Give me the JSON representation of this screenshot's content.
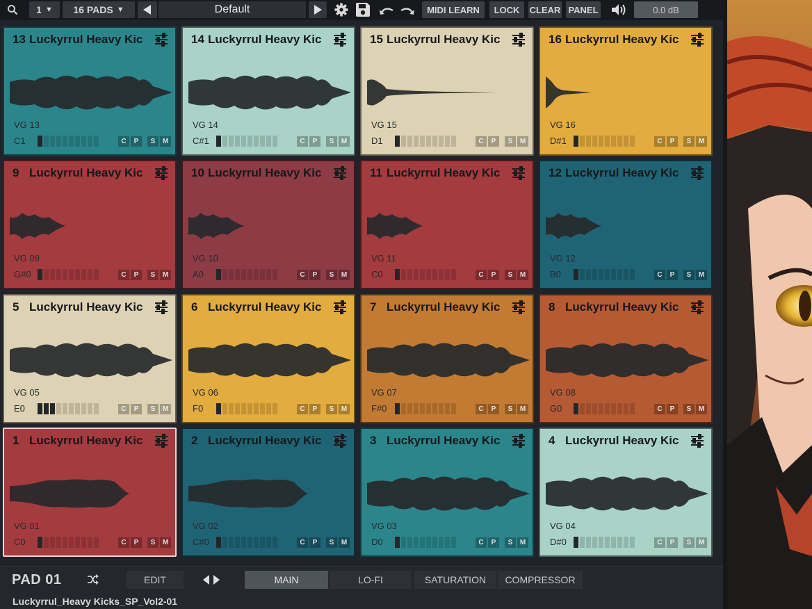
{
  "toolbar": {
    "channel": "1",
    "pads_mode": "16 PADS",
    "preset": "Default",
    "midi_learn": "MIDI LEARN",
    "lock": "LOCK",
    "clear": "CLEAR",
    "panel": "PANEL",
    "volume": "0.0 dB"
  },
  "colors": {
    "teal": "#2b868c",
    "pale_teal": "#a9d3c6",
    "cream": "#ddd2b3",
    "gold": "#e3ac3e",
    "red": "#a43b3f",
    "wine": "#8d3b45",
    "dark_teal": "#1f6475",
    "orange": "#c37b33",
    "rust": "#b65a33",
    "waveform": "#26292b"
  },
  "pads": [
    {
      "num": "13",
      "name": "Luckyrrul Heavy Kic",
      "vg": "VG 13",
      "note": "C1",
      "color": "#2b868c",
      "level": 1,
      "wave": "long"
    },
    {
      "num": "14",
      "name": "Luckyrrul Heavy Kic",
      "vg": "VG 14",
      "note": "C#1",
      "color": "#a9d3c6",
      "level": 1,
      "wave": "long"
    },
    {
      "num": "15",
      "name": "Luckyrrul Heavy Kic",
      "vg": "VG 15",
      "note": "D1",
      "color": "#ddd2b3",
      "level": 1,
      "wave": "decay"
    },
    {
      "num": "16",
      "name": "Luckyrrul Heavy Kic",
      "vg": "VG 16",
      "note": "D#1",
      "color": "#e3ac3e",
      "level": 1,
      "wave": "shortdecay"
    },
    {
      "num": "9",
      "name": "Luckyrrul Heavy Kic",
      "vg": "VG 09",
      "note": "G#0",
      "color": "#a43b3f",
      "level": 1,
      "wave": "short"
    },
    {
      "num": "10",
      "name": "Luckyrrul Heavy Kic",
      "vg": "VG 10",
      "note": "A0",
      "color": "#8d3b45",
      "level": 1,
      "wave": "short"
    },
    {
      "num": "11",
      "name": "Luckyrrul Heavy Kic",
      "vg": "VG 11",
      "note": "C0",
      "color": "#a43b3f",
      "level": 1,
      "wave": "short"
    },
    {
      "num": "12",
      "name": "Luckyrrul Heavy Kic",
      "vg": "VG 12",
      "note": "B0",
      "color": "#1f6475",
      "level": 1,
      "wave": "short"
    },
    {
      "num": "5",
      "name": "Luckyrrul Heavy Kic",
      "vg": "VG 05",
      "note": "E0",
      "color": "#ddd2b3",
      "level": 3,
      "wave": "long"
    },
    {
      "num": "6",
      "name": "Luckyrrul Heavy Kic",
      "vg": "VG 06",
      "note": "F0",
      "color": "#e3ac3e",
      "level": 1,
      "wave": "long"
    },
    {
      "num": "7",
      "name": "Luckyrrul Heavy Kic",
      "vg": "VG 07",
      "note": "F#0",
      "color": "#c37b33",
      "level": 1,
      "wave": "long"
    },
    {
      "num": "8",
      "name": "Luckyrrul Heavy Kic",
      "vg": "VG 08",
      "note": "G0",
      "color": "#b65a33",
      "level": 1,
      "wave": "long"
    },
    {
      "num": "1",
      "name": "Luckyrrul Heavy Kic",
      "vg": "VG 01",
      "note": "C0",
      "color": "#a43b3f",
      "level": 1,
      "wave": "medium",
      "selected": true
    },
    {
      "num": "2",
      "name": "Luckyrrul Heavy Kic",
      "vg": "VG 02",
      "note": "C#0",
      "color": "#1f6475",
      "level": 1,
      "wave": "medium"
    },
    {
      "num": "3",
      "name": "Luckyrrul Heavy Kic",
      "vg": "VG 03",
      "note": "D0",
      "color": "#2b868c",
      "level": 1,
      "wave": "long"
    },
    {
      "num": "4",
      "name": "Luckyrrul Heavy Kic",
      "vg": "VG 04",
      "note": "D#0",
      "color": "#a9d3c6",
      "level": 1,
      "wave": "long"
    }
  ],
  "pad_buttons": [
    "C",
    "P",
    "S",
    "M"
  ],
  "bottom": {
    "pad_label": "PAD 01",
    "edit": "EDIT",
    "tabs": [
      "MAIN",
      "LO-FI",
      "SATURATION",
      "COMPRESSOR"
    ],
    "active_tab": "MAIN",
    "sample_name": "Luckyrrul_Heavy Kicks_SP_Vol2-01"
  }
}
